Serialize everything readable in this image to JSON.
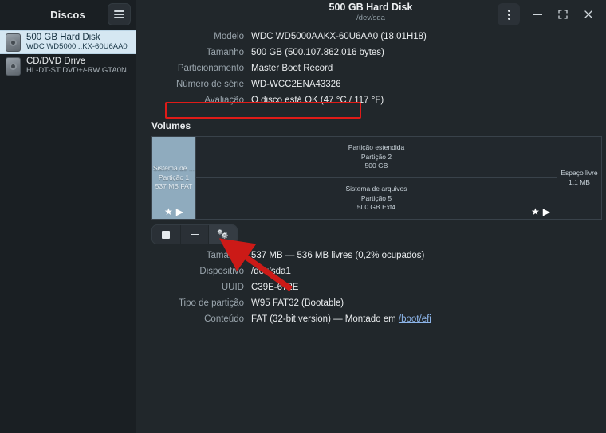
{
  "sidebar": {
    "title": "Discos",
    "menu_icon": "hamburger-icon",
    "items": [
      {
        "name": "500 GB Hard Disk",
        "sub": "WDC WD5000...KX-60U6AA0",
        "selected": true
      },
      {
        "name": "CD/DVD Drive",
        "sub": "HL-DT-ST DVD+/-RW GTA0N",
        "selected": false
      }
    ]
  },
  "titlebar": {
    "title": "500 GB Hard Disk",
    "subtitle": "/dev/sda",
    "menu_icon": "kebab-menu-icon",
    "minimize_icon": "minimize-icon",
    "maximize_icon": "maximize-icon",
    "close_icon": "close-icon"
  },
  "drive_properties": [
    {
      "label": "Modelo",
      "value": "WDC WD5000AAKX-60U6AA0 (18.01H18)"
    },
    {
      "label": "Tamanho",
      "value": "500 GB (500.107.862.016 bytes)"
    },
    {
      "label": "Particionamento",
      "value": "Master Boot Record"
    },
    {
      "label": "Número de série",
      "value": "WD-WCC2ENA43326"
    },
    {
      "label": "Avaliação",
      "value": "O disco está OK (47 °C / 117 °F)"
    }
  ],
  "volumes": {
    "heading": "Volumes",
    "partition1": {
      "line1": "Sistema de ...",
      "line2": "Partição 1",
      "line3": "537 MB FAT"
    },
    "extended": {
      "line1": "Partição estendida",
      "line2": "Partição 2",
      "line3": "500 GB"
    },
    "partition5": {
      "line1": "Sistema de arquivos",
      "line2": "Partição 5",
      "line3": "500 GB Ext4"
    },
    "freespace": {
      "line1": "Espaço livre",
      "line2": "1,1 MB"
    },
    "badge_star": "★",
    "badge_play": "▶",
    "toolbar": {
      "unmount_label": "unmount-volume",
      "delete_label": "delete-partition",
      "settings_label": "additional-partition-options"
    }
  },
  "volume_properties": [
    {
      "label": "Tamanho",
      "value": "537 MB — 536 MB livres (0,2% ocupados)"
    },
    {
      "label": "Dispositivo",
      "value": "/dev/sda1"
    },
    {
      "label": "UUID",
      "value": "C39E-672E"
    },
    {
      "label": "Tipo de partição",
      "value": "W95 FAT32 (Bootable)"
    },
    {
      "label": "Conteúdo",
      "value": "FAT (32-bit version) — Montado em ",
      "link": "/boot/efi"
    }
  ],
  "annotations": {
    "highlight_color": "#e01b18",
    "arrow_color": "#cc1a17"
  }
}
